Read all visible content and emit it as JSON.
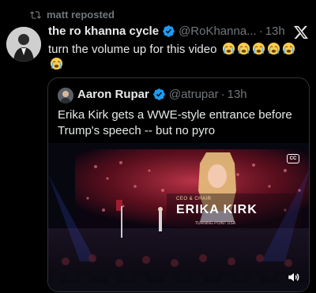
{
  "repost": {
    "label": "matt reposted"
  },
  "tweet": {
    "author_name": "the ro khanna cycle",
    "handle": "@RoKhanna...",
    "separator": "·",
    "time": "13h",
    "text": "turn the volume up for this video",
    "emoji_count": 6
  },
  "quote": {
    "author_name": "Aaron Rupar",
    "handle": "@atrupar",
    "separator": "·",
    "time": "13h",
    "text": "Erika Kirk gets a WWE-style entrance before Trump's speech -- but no pyro",
    "video": {
      "banner_title": "CEO & CHAIR",
      "banner_name": "ERIKA KIRK",
      "banner_sub": "TURNING POINT USA"
    }
  },
  "colors": {
    "verified": "#1d9bf0",
    "secondary_text": "#71767b",
    "border": "#2f3336"
  },
  "icons": [
    "repost-icon",
    "verified-icon",
    "x-logo-icon",
    "crying-emoji-icon",
    "speaker-icon",
    "captions-icon"
  ]
}
